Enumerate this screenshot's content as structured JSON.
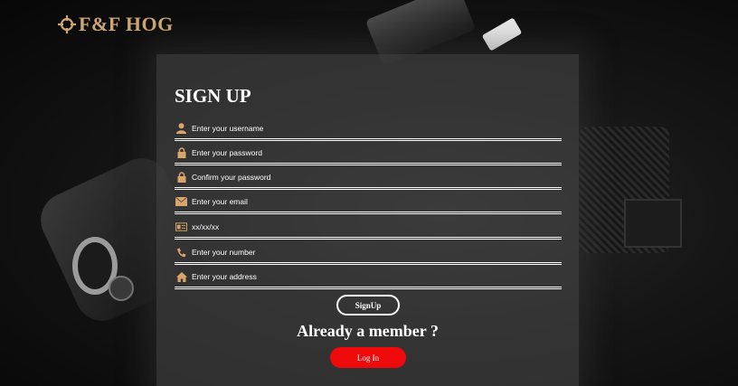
{
  "brand": {
    "name": "F&F HOG",
    "logo_icon": "crosshair-icon",
    "color": "#cfa574"
  },
  "form": {
    "title": "SIGN UP",
    "fields": [
      {
        "name": "username",
        "placeholder": "Enter your username",
        "icon": "user-icon"
      },
      {
        "name": "password",
        "placeholder": "Enter your password",
        "icon": "lock-icon"
      },
      {
        "name": "confirm_password",
        "placeholder": "Confirm your password",
        "icon": "lock-icon"
      },
      {
        "name": "email",
        "placeholder": "Enter your email",
        "icon": "envelope-icon"
      },
      {
        "name": "date",
        "placeholder": "xx/xx/xx",
        "icon": "id-card-icon"
      },
      {
        "name": "number",
        "placeholder": "Enter your number",
        "icon": "phone-icon"
      },
      {
        "name": "address",
        "placeholder": "Enter your address",
        "icon": "home-icon"
      }
    ],
    "signup_label": "SignUp",
    "member_text": "Already a member ?",
    "login_label": "Log In"
  },
  "colors": {
    "accent_icon": "#d9a56a",
    "login_button": "#ee0a0a",
    "text": "#ffffff"
  }
}
